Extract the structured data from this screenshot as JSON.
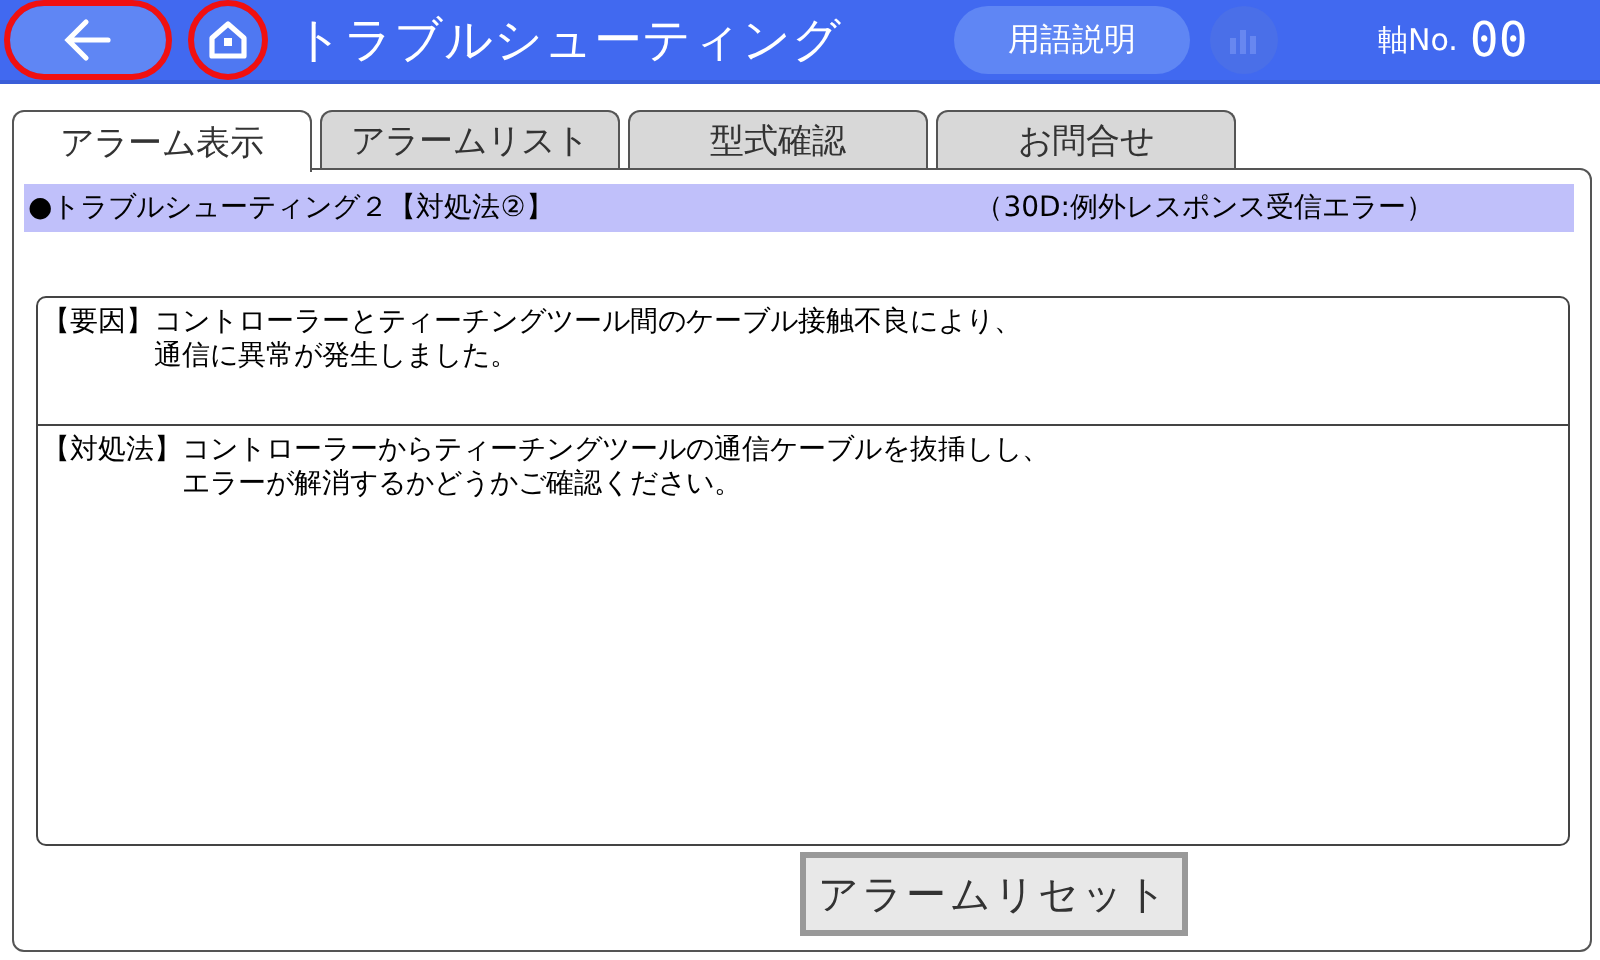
{
  "header": {
    "back_button": {
      "highlighted": true
    },
    "home_button": {
      "highlighted": true
    },
    "title": "トラブルシューティング",
    "glossary_button": "用語説明",
    "chart_button": {
      "disabled": true
    },
    "axis_label": "軸No.",
    "axis_number": "00"
  },
  "tabs": [
    {
      "label": "アラーム表示",
      "selected": true
    },
    {
      "label": "アラームリスト",
      "selected": false
    },
    {
      "label": "型式確認",
      "selected": false
    },
    {
      "label": "お問合せ",
      "selected": false
    }
  ],
  "banner": {
    "title": "●トラブルシューティング２【対処法②】",
    "code": "（30D:例外レスポンス受信エラー）"
  },
  "sections": [
    {
      "label": "【要因】",
      "lines": [
        "コントローラーとティーチングツール間のケーブル接触不良により、",
        "通信に異常が発生しました。"
      ]
    },
    {
      "label": "【対処法】",
      "lines": [
        "コントローラーからティーチングツールの通信ケーブルを抜挿しし、",
        "エラーが解消するかどうかご確認ください。"
      ]
    }
  ],
  "reset_button": "アラームリセット"
}
